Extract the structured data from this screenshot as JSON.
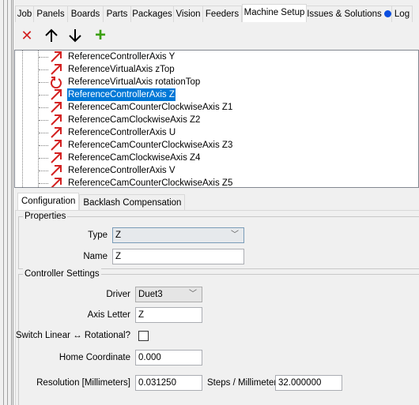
{
  "tabs": [
    "Job",
    "Panels",
    "Boards",
    "Parts",
    "Packages",
    "Vision",
    "Feeders",
    "Machine Setup",
    "Issues & Solutions",
    "Log"
  ],
  "active_tab": "Machine Setup",
  "toolbar": {
    "delete": "✕",
    "up": "🡑",
    "down": "🡓",
    "add": "+"
  },
  "tree": {
    "items": [
      {
        "label": "ReferenceControllerAxis Y",
        "icon": "linear-axis-icon"
      },
      {
        "label": "ReferenceVirtualAxis zTop",
        "icon": "linear-axis-icon"
      },
      {
        "label": "ReferenceVirtualAxis rotationTop",
        "icon": "rotation-axis-icon"
      },
      {
        "label": "ReferenceControllerAxis Z",
        "icon": "linear-axis-icon",
        "selected": true
      },
      {
        "label": "ReferenceCamCounterClockwiseAxis Z1",
        "icon": "linear-axis-icon"
      },
      {
        "label": "ReferenceCamClockwiseAxis Z2",
        "icon": "linear-axis-icon"
      },
      {
        "label": "ReferenceControllerAxis U",
        "icon": "linear-axis-icon"
      },
      {
        "label": "ReferenceCamCounterClockwiseAxis Z3",
        "icon": "linear-axis-icon"
      },
      {
        "label": "ReferenceCamClockwiseAxis Z4",
        "icon": "linear-axis-icon"
      },
      {
        "label": "ReferenceControllerAxis V",
        "icon": "linear-axis-icon"
      },
      {
        "label": "ReferenceCamCounterClockwiseAxis Z5",
        "icon": "linear-axis-icon"
      }
    ]
  },
  "config_tabs": [
    "Configuration",
    "Backlash Compensation"
  ],
  "properties": {
    "title": "Properties",
    "type_label": "Type",
    "type_value": "Z",
    "name_label": "Name",
    "name_value": "Z"
  },
  "controller": {
    "title": "Controller Settings",
    "driver_label": "Driver",
    "driver_value": "Duet3",
    "axis_letter_label": "Axis Letter",
    "axis_letter_value": "Z",
    "switch_label": "Switch Linear ↔ Rotational?",
    "switch_checked": false,
    "home_label": "Home Coordinate",
    "home_value": "0.000",
    "resolution_label": "Resolution [Millimeters]",
    "resolution_value": "0.031250",
    "steps_label": "Steps / Millimeter",
    "steps_value": "32.000000"
  },
  "colors": {
    "selection": "#0078d7",
    "delete": "#d21f1f",
    "add": "#3ca00f",
    "axis_icon": "#d42020",
    "issues_dot": "#0a4ee0"
  }
}
